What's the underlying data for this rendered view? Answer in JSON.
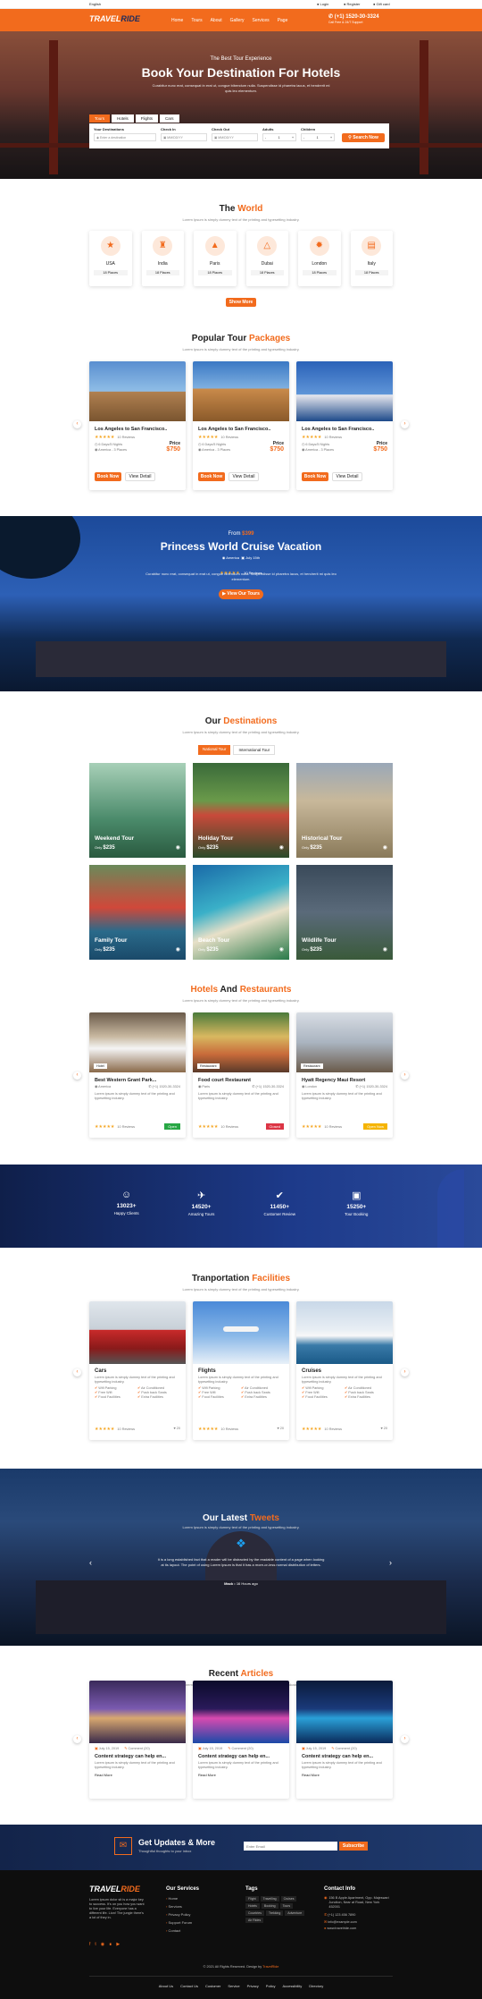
{
  "topbar": {
    "language": "English",
    "login": "Login",
    "register": "Register",
    "gift": "Gift card"
  },
  "header": {
    "logo1": "TRAVEL",
    "logo2": "RIDE",
    "nav": [
      "Home",
      "Tours",
      "About",
      "Gallery",
      "Services",
      "Page"
    ],
    "phone": "(+1) 1520-30-3324",
    "phone_sub": "Call Free & 24/7 Support"
  },
  "hero": {
    "kicker": "The Best Tour Experience",
    "title": "Book Your Destination For Hotels",
    "desc": "Curabitur nunc erat, consequat in erat ut, congue bibendum nulla. Suspendisse id pharetra lacus, et hendrerit mi quis leo elementum.",
    "tabs": [
      "Tours",
      "Hotels",
      "Flights",
      "Cars"
    ],
    "fields": [
      {
        "label": "Your Destinations",
        "value": "Enter a destination"
      },
      {
        "label": "Check In",
        "value": "MM/DD/YY"
      },
      {
        "label": "Check Out",
        "value": "MM/DD/YY"
      },
      {
        "label": "Adults",
        "value": "1"
      },
      {
        "label": "Children",
        "value": "1"
      }
    ],
    "search": "Search Now"
  },
  "world": {
    "t1": "The ",
    "t2": "World",
    "sub": "Lorem Ipsum is simply dummy text of the printing and typesetting industry.",
    "items": [
      {
        "name": "USA",
        "places": "18 Places"
      },
      {
        "name": "India",
        "places": "18 Places"
      },
      {
        "name": "Paris",
        "places": "18 Places"
      },
      {
        "name": "Dubai",
        "places": "18 Places"
      },
      {
        "name": "London",
        "places": "18 Places"
      },
      {
        "name": "Italy",
        "places": "18 Places"
      }
    ],
    "more": "Show More"
  },
  "packages": {
    "t1": "Popular Tour ",
    "t2": "Packages",
    "sub": "Lorem Ipsum is simply dummy text of the printing and typesetting industry.",
    "items": [
      {
        "title": "Los Angeles to San Francisco..",
        "reviews": "10 Reviews",
        "days": "6 Days/5 Nights",
        "loc": "America - 3 Places",
        "price_label": "Price",
        "price": "$750",
        "book": "Book Now",
        "detail": "View Detail"
      },
      {
        "title": "Los Angeles to San Francisco..",
        "reviews": "10 Reviews",
        "days": "6 Days/5 Nights",
        "loc": "America - 3 Places",
        "price_label": "Price",
        "price": "$750",
        "book": "Book Now",
        "detail": "View Detail"
      },
      {
        "title": "Los Angeles to San Francisco..",
        "reviews": "10 Reviews",
        "days": "6 Days/5 Nights",
        "loc": "America - 3 Places",
        "price_label": "Price",
        "price": "$750",
        "book": "Book Now",
        "detail": "View Detail"
      }
    ]
  },
  "cruise": {
    "from": "From ",
    "price": "$399",
    "title": "Princess World Cruise Vacation",
    "loc": "America",
    "date": "July 15th",
    "reviews": "10 Reviews",
    "desc": "Curabitur nunc erat, consequat in erat ut, congue bibendum nulla. Suspendisse id pharetra lacus, et hendrerit mi quis leo elementum.",
    "btn": "View Our Tours"
  },
  "destinations": {
    "t1": "Our ",
    "t2": "Destinations",
    "sub": "Lorem Ipsum is simply dummy text of the printing and typesetting industry.",
    "tabs": [
      "National Tour",
      "International Tour"
    ],
    "items": [
      {
        "name": "Weekend Tour",
        "only": "Only",
        "price": "$235"
      },
      {
        "name": "Holiday Tour",
        "only": "Only",
        "price": "$235"
      },
      {
        "name": "Historical Tour",
        "only": "Only",
        "price": "$235"
      },
      {
        "name": "Family Tour",
        "only": "Only",
        "price": "$235"
      },
      {
        "name": "Beach Tour",
        "only": "Only",
        "price": "$235"
      },
      {
        "name": "Wildlife Tour",
        "only": "Only",
        "price": "$235"
      }
    ]
  },
  "hotels": {
    "t1": "Hotels ",
    "t2": "And ",
    "t3": "Restaurants",
    "sub": "Lorem Ipsum is simply dummy text of the printing and typesetting industry.",
    "items": [
      {
        "tag": "Hotel",
        "name": "Best Western Grant Park...",
        "loc": "America",
        "phone": "(+1) 1520-30-3324",
        "desc": "Lorem ipsum is simply dummy text of the printing and typesetting industry.",
        "reviews": "10 Reviews",
        "status": "Open"
      },
      {
        "tag": "Restaurant",
        "name": "Food court Restaurant",
        "loc": "Paris",
        "phone": "(+1) 1520-30-3324",
        "desc": "Lorem ipsum is simply dummy text of the printing and typesetting industry.",
        "reviews": "10 Reviews",
        "status": "Closed"
      },
      {
        "tag": "Restaurant",
        "name": "Hyatt Regency Maui Resort",
        "loc": "London",
        "phone": "(+1) 1520-30-3324",
        "desc": "Lorem ipsum is simply dummy text of the printing and typesetting industry.",
        "reviews": "10 Reviews",
        "status": "Open Now"
      }
    ]
  },
  "stats": [
    {
      "num": "13023+",
      "label": "Happy Clients"
    },
    {
      "num": "14520+",
      "label": "Amazing Tours"
    },
    {
      "num": "11450+",
      "label": "Customer Review"
    },
    {
      "num": "15250+",
      "label": "Tour Booking"
    }
  ],
  "transport": {
    "t1": "Tranportation ",
    "t2": "Facilities",
    "sub": "Lorem Ipsum is simply dummy text of the printing and typesetting industry.",
    "items": [
      {
        "name": "Cars",
        "desc": "Lorem ipsum is simply dummy text of the printing and typesetting industry.",
        "f": [
          "Wifi Parking",
          "Air Conditioned",
          "Free Wifi",
          "Push back Seats",
          "Food Facilities",
          "Extra Facilities"
        ],
        "reviews": "10 Reviews",
        "likes": "20"
      },
      {
        "name": "Flights",
        "desc": "Lorem ipsum is simply dummy text of the printing and typesetting industry.",
        "f": [
          "Wifi Parking",
          "Air Conditioned",
          "Free Wifi",
          "Push back Seats",
          "Food Facilities",
          "Extra Facilities"
        ],
        "reviews": "10 Reviews",
        "likes": "20"
      },
      {
        "name": "Cruises",
        "desc": "Lorem ipsum is simply dummy text of the printing and typesetting industry.",
        "f": [
          "Wifi Parking",
          "Air Conditioned",
          "Free Wifi",
          "Push back Seats",
          "Food Facilities",
          "Extra Facilities"
        ],
        "reviews": "10 Reviews",
        "likes": "20"
      }
    ]
  },
  "tweets": {
    "t1": "Our Latest ",
    "t2": "Tweets",
    "sub": "Lorem Ipsum is simply dummy text of the printing and typesetting industry.",
    "text": "It is a long established fact that a reader will be distracted by the readable content of a page when looking at its layout. The point of using Lorem Ipsum is that it has a more-or-less normal distribution of letters.",
    "author": "Mack",
    "time": "16 Hours ago"
  },
  "articles": {
    "t1": "Recent ",
    "t2": "Articles",
    "sub": "Lorem Ipsum is simply dummy text of the printing and typesetting industry.",
    "items": [
      {
        "date": "July 15, 2019",
        "comments": "Comment (20)",
        "title": "Content strategy can help en...",
        "desc": "Lorem ipsum is simply dummy text of the printing and typesetting industry.",
        "more": "Read More"
      },
      {
        "date": "July 15, 2019",
        "comments": "Comment (20)",
        "title": "Content strategy can help en...",
        "desc": "Lorem ipsum is simply dummy text of the printing and typesetting industry.",
        "more": "Read More"
      },
      {
        "date": "July 15, 2019",
        "comments": "Comment (20)",
        "title": "Content strategy can help en...",
        "desc": "Lorem ipsum is simply dummy text of the printing and typesetting industry.",
        "more": "Read More"
      }
    ]
  },
  "newsletter": {
    "title": "Get Updates & More",
    "sub": "Thoughtful thoughts to your inbox",
    "placeholder": "Enter Email",
    "btn": "Subscribe"
  },
  "footer": {
    "desc": "Lorem ipsum dolor sit is a major key to success. It's on you how you want to live your life. Everyone has a different life. Lion! The jungle there's a lot of they in.",
    "services_title": "Our Services",
    "services": [
      "Home",
      "Services",
      "Privacy Policy",
      "Support Forum",
      "Contact"
    ],
    "tags_title": "Tags",
    "tags": [
      "Flight",
      "Travelling",
      "Cruises",
      "Hotels",
      "Booking",
      "Tours",
      "Countries",
      "Trekking",
      "Adventure",
      "Air Rides"
    ],
    "contact_title": "Contact Info",
    "address": "156 B Apple Apartment, Opp. Majeswari Junction, Near at Road, New York 452001",
    "phone": "(+1) 123 456 7890",
    "email": "info@example.com",
    "site": "www.travelride.com",
    "copyright": "© 2021 All Rights Reserved. Design by ",
    "designer": "TravelRide",
    "links": [
      "About Us",
      "Contact Us",
      "Customer",
      "Service",
      "Privacy",
      "Policy",
      "Accessibility",
      "Directory"
    ]
  },
  "colors": {
    "accent": "#f26b1d",
    "dark": "#1d2b5c",
    "footer": "#0e0e0e"
  }
}
